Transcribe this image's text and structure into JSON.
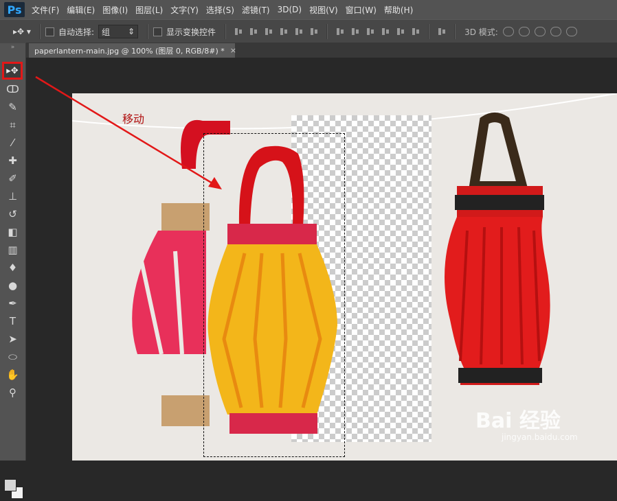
{
  "app": {
    "logo": "Ps"
  },
  "menu": [
    "文件(F)",
    "编辑(E)",
    "图像(I)",
    "图层(L)",
    "文字(Y)",
    "选择(S)",
    "滤镜(T)",
    "3D(D)",
    "视图(V)",
    "窗口(W)",
    "帮助(H)"
  ],
  "options": {
    "auto_select_label": "自动选择:",
    "auto_select_value": "组",
    "transform_label": "显示变换控件",
    "mode3d_label": "3D 模式:"
  },
  "document": {
    "tab_title": "paperlantern-main.jpg @ 100% (图层 0, RGB/8#) *",
    "close": "×"
  },
  "annotation": {
    "label": "移动",
    "color": "#e21818"
  },
  "watermark": {
    "text": "Bai 经验",
    "sub": "jingyan.baidu.com"
  },
  "icons": [
    "move-tool-icon",
    "marquee-icon",
    "lasso-icon",
    "quick-select-icon",
    "crop-icon",
    "eyedropper-icon",
    "healing-icon",
    "brush-icon",
    "stamp-icon",
    "history-brush-icon",
    "eraser-icon",
    "gradient-icon",
    "blur-icon",
    "dodge-icon",
    "pen-icon",
    "type-icon",
    "path-select-icon",
    "ellipse-icon",
    "hand-icon",
    "zoom-icon"
  ],
  "colors": {
    "accent": "#e21818",
    "foreground": "#d6d6d6",
    "background": "#f2f2f2"
  }
}
